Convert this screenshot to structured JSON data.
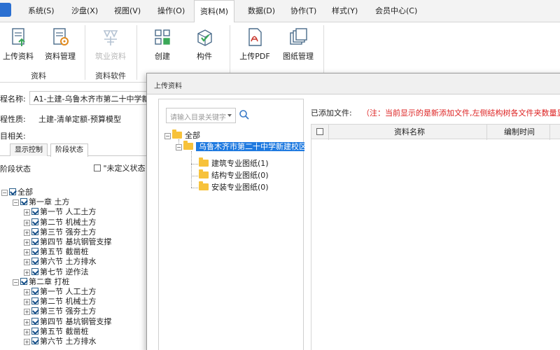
{
  "menu": {
    "items": [
      "系统(S)",
      "沙盘(X)",
      "视图(V)",
      "操作(O)",
      "资料(M)",
      "数据(D)",
      "协作(T)",
      "样式(Y)",
      "会员中心(C)"
    ],
    "active_index": 4
  },
  "ribbon": {
    "buttons": [
      {
        "label": "上传资料",
        "icon": "upload-document-icon",
        "enabled": true
      },
      {
        "label": "资料管理",
        "icon": "document-settings-icon",
        "enabled": true
      },
      {
        "label": "筑业资料",
        "icon": "zhuye-document-icon",
        "enabled": false
      },
      {
        "label": "创建",
        "icon": "create-grid-icon",
        "enabled": true
      },
      {
        "label": "构件",
        "icon": "component-icon",
        "enabled": true
      },
      {
        "label": "上传PDF",
        "icon": "pdf-upload-icon",
        "enabled": true
      },
      {
        "label": "图纸管理",
        "icon": "drawing-management-icon",
        "enabled": true
      }
    ],
    "groups": [
      "资料",
      "资料软件"
    ]
  },
  "left_panel": {
    "project_name_label": "程名称:",
    "project_name_value": "A1-土建-乌鲁木齐市第二十中学新",
    "project_type_label": "程性质:",
    "project_type_value": "土建-清单定额-预算模型",
    "project_related_label": "目相关:",
    "tabs": [
      "显示控制",
      "阶段状态"
    ],
    "active_tab": 1,
    "stage_status_label": "阶段状态",
    "undefined_status_label": "\"未定义状态",
    "tree": [
      {
        "level": 0,
        "label": "全部",
        "expander": "minus"
      },
      {
        "level": 1,
        "label": "第一章  土方",
        "expander": "minus"
      },
      {
        "level": 2,
        "label": "第一节  人工土方",
        "expander": "plus"
      },
      {
        "level": 2,
        "label": "第二节  机械土方",
        "expander": "plus"
      },
      {
        "level": 2,
        "label": "第三节  强夯土方",
        "expander": "plus"
      },
      {
        "level": 2,
        "label": "第四节  基坑钢管支撑",
        "expander": "plus"
      },
      {
        "level": 2,
        "label": "第五节  截凿桩",
        "expander": "plus"
      },
      {
        "level": 2,
        "label": "第六节  土方排水",
        "expander": "plus"
      },
      {
        "level": 2,
        "label": "第七节  逆作法",
        "expander": "plus"
      },
      {
        "level": 1,
        "label": "第二章  打桩",
        "expander": "minus"
      },
      {
        "level": 2,
        "label": "第一节  人工土方",
        "expander": "plus"
      },
      {
        "level": 2,
        "label": "第二节  机械土方",
        "expander": "plus"
      },
      {
        "level": 2,
        "label": "第三节  强夯土方",
        "expander": "plus"
      },
      {
        "level": 2,
        "label": "第四节  基坑钢管支撑",
        "expander": "plus"
      },
      {
        "level": 2,
        "label": "第五节  截凿桩",
        "expander": "plus"
      },
      {
        "level": 2,
        "label": "第六节  土方排水",
        "expander": "plus"
      }
    ]
  },
  "dialog": {
    "title": "上传资料",
    "search_placeholder": "请输入目录关键字",
    "tree": {
      "root": "全部",
      "project": "乌鲁木齐市第二十中学新建校区-番",
      "children": [
        "建筑专业图纸(1)",
        "结构专业图纸(0)",
        "安装专业图纸(0)"
      ]
    },
    "added_files_label": "已添加文件:",
    "notice": "（注：当前显示的是新添加文件,左侧结构树各文件夹数量显示",
    "table_headers": [
      "资料名称",
      "编制时间"
    ]
  }
}
